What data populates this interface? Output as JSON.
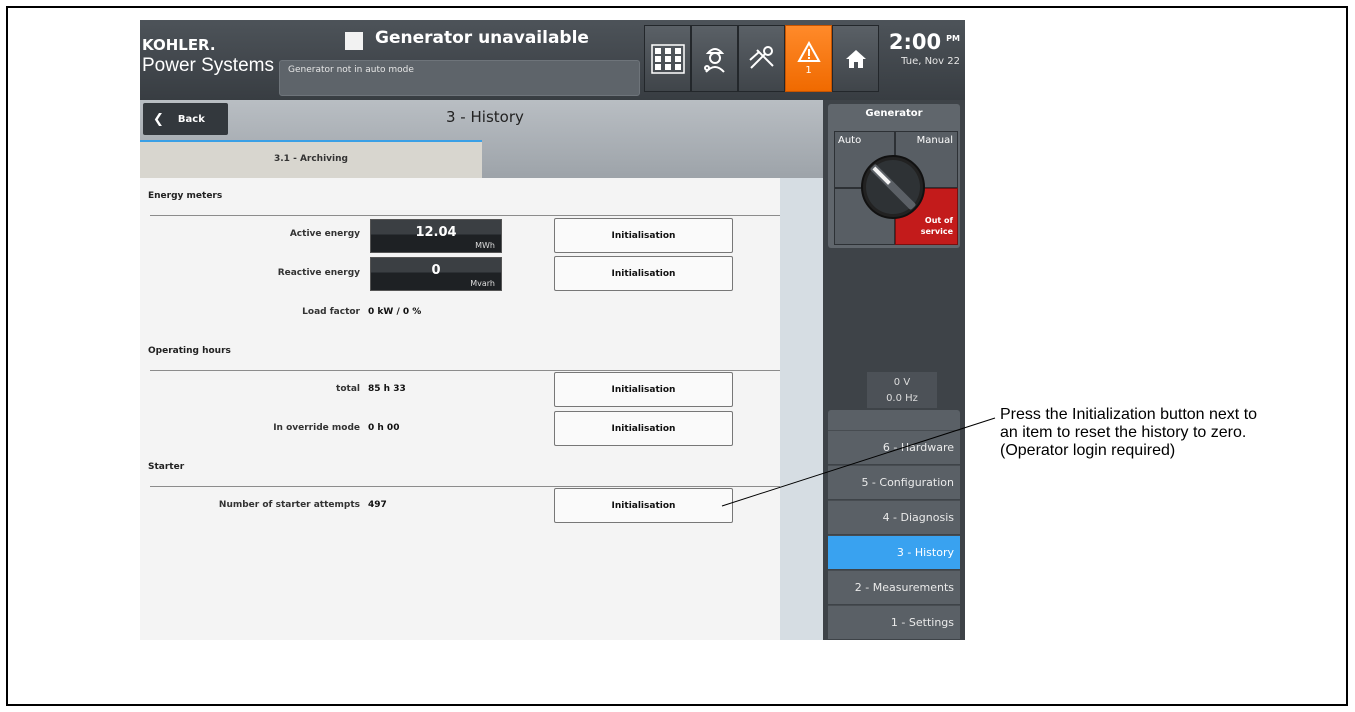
{
  "header": {
    "brand": "KOHLER.",
    "brand_sub": "Power Systems",
    "status_title": "Generator unavailable",
    "status_message": "Generator not in auto mode",
    "warning_count": "1",
    "clock_time": "2:00",
    "clock_ampm": "PM",
    "clock_date": "Tue, Nov 22",
    "icons": [
      "grid-icon",
      "technician-icon",
      "tools-icon",
      "warning-icon",
      "home-icon"
    ],
    "warning_color": "#f47a12"
  },
  "nav": {
    "back_label": "Back",
    "page_title": "3 - History",
    "tab_label": "3.1 - Archiving"
  },
  "sections": {
    "energy": {
      "title": "Energy meters",
      "active_label": "Active energy",
      "active_value": "12.04",
      "active_unit": "MWh",
      "reactive_label": "Reactive energy",
      "reactive_value": "0",
      "reactive_unit": "Mvarh",
      "load_label": "Load factor",
      "load_value": "0 kW / 0 %"
    },
    "hours": {
      "title": "Operating hours",
      "total_label": "total",
      "total_value": "85 h 33",
      "override_label": "In override mode",
      "override_value": "0 h 00"
    },
    "starter": {
      "title": "Starter",
      "attempts_label": "Number of starter attempts",
      "attempts_value": "497"
    },
    "init_label": "Initialisation"
  },
  "generator": {
    "title": "Generator",
    "auto": "Auto",
    "manual": "Manual",
    "out_of_service_line1": "Out of",
    "out_of_service_line2": "service",
    "voltage": "0 V",
    "frequency": "0.0 Hz",
    "oos_color": "#c31b1b"
  },
  "menu": {
    "items": [
      "6 - Hardware",
      "5 - Configuration",
      "4 - Diagnosis",
      "3 - History",
      "2 - Measurements",
      "1 - Settings"
    ],
    "active_index": 3,
    "active_color": "#39a2f0"
  },
  "callout": {
    "text_line1": "Press the Initialization button next to",
    "text_line2": "an item to reset the history to zero.",
    "text_line3": "(Operator login required)"
  }
}
